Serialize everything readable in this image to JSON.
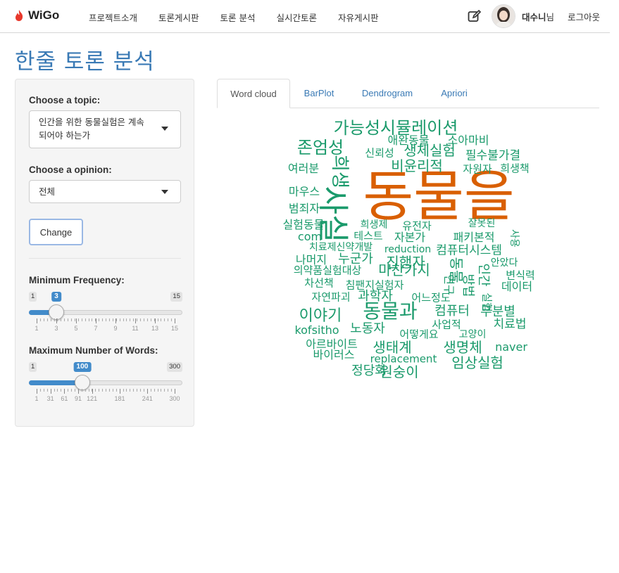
{
  "brand": {
    "name": "WiGo",
    "accent": "#e8382c"
  },
  "nav": {
    "links": [
      "프로젝트소개",
      "토론게시판",
      "토론 분석",
      "실시간토론",
      "자유게시판"
    ],
    "user_name": "대수니",
    "user_suffix": "님",
    "logout": "로그아웃"
  },
  "page_title": "한줄 토론 분석",
  "sidebar": {
    "topic_label": "Choose a topic:",
    "topic_value_line1": "인간을 위한 동물실험은 계속",
    "topic_value_line2": "되어야 하는가",
    "opinion_label": "Choose a opinion:",
    "opinion_value": "전체",
    "change_button": "Change",
    "min_freq": {
      "label": "Minimum Frequency:",
      "min": "1",
      "max": "15",
      "value": "3",
      "min_num": 1,
      "max_num": 15,
      "value_num": 3,
      "tick_labels": [
        "1",
        "3",
        "5",
        "7",
        "9",
        "11",
        "13",
        "15"
      ],
      "tick_values": [
        1,
        3,
        5,
        7,
        9,
        11,
        13,
        15
      ]
    },
    "max_words": {
      "label": "Maximum Number of Words:",
      "min": "1",
      "max": "300",
      "value": "100",
      "min_num": 1,
      "max_num": 300,
      "value_num": 100,
      "tick_labels": [
        "1",
        "31",
        "61",
        "91",
        "121",
        "181",
        "241",
        "300"
      ],
      "tick_values": [
        1,
        31,
        61,
        91,
        121,
        181,
        241,
        300
      ]
    }
  },
  "tabs": [
    "Word cloud",
    "BarPlot",
    "Dendrogram",
    "Apriori"
  ],
  "colors": {
    "title": "#3a7ab5",
    "cloud_green": "#1a9a6b",
    "cloud_orange": "#d95f02",
    "slider_blue": "#428bca"
  },
  "wordcloud": {
    "words": [
      "동물을",
      "가능성시뮬레이션",
      "존엄성",
      "애완동물",
      "소아마비",
      "신뢰성",
      "생체실험",
      "필수불가결",
      "비윤리적",
      "자원자",
      "희생책",
      "여러분",
      "마우스",
      "범죄자",
      "실험동물",
      "희생제",
      "유전자",
      "잘못된",
      "com",
      "테스트",
      "자본가",
      "패키본적",
      "치료제신약개발",
      "reduction",
      "컴퓨터시스템",
      "나머지",
      "누군가",
      "진행자",
      "의약품실험대상",
      "마찬가지",
      "안았다",
      "변식력",
      "차선책",
      "침팬지실험자",
      "데이터",
      "자연파괴",
      "과학자",
      "어느정도",
      "이야기",
      "동물과",
      "컴퓨터",
      "무분별",
      "kofsitho",
      "노동자",
      "사업적",
      "고양이",
      "치료법",
      "어떻게요",
      "아르바이트",
      "생태계",
      "생명체",
      "naver",
      "바이러스",
      "replacement",
      "임상실험",
      "정당화",
      "원숭이",
      "사실",
      "희생",
      "동물",
      "사용",
      "인간",
      "연구",
      "방법",
      "실험"
    ]
  }
}
